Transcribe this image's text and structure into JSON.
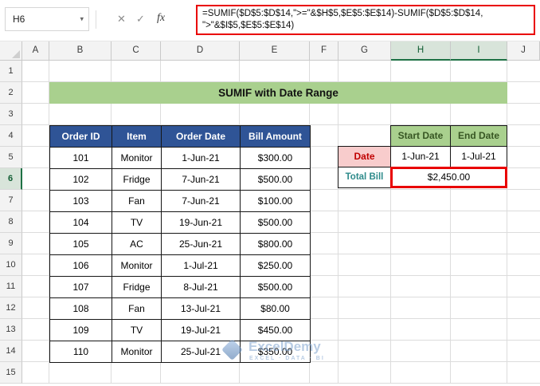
{
  "formula_bar": {
    "name_box": "H6",
    "dropdown_icon": "▾",
    "cancel_label": "✕",
    "enter_label": "✓",
    "fx_label": "fx",
    "formula_line1": "=SUMIF($D$5:$D$14,\">=\"&$H$5,$E$5:$E$14)-SUMIF($D$5:$D$14,",
    "formula_line2": "\">\"&$I$5,$E$5:$E$14)"
  },
  "grid": {
    "columns": [
      "A",
      "B",
      "C",
      "D",
      "E",
      "F",
      "G",
      "H",
      "I",
      "J"
    ],
    "selected_columns": [
      "H",
      "I"
    ],
    "rows": [
      "1",
      "2",
      "3",
      "4",
      "5",
      "6",
      "7",
      "8",
      "9",
      "10",
      "11",
      "12",
      "13",
      "14",
      "15"
    ],
    "selected_row": "6"
  },
  "title_banner": "SUMIF with Date Range",
  "main_table": {
    "headers": [
      "Order ID",
      "Item",
      "Order Date",
      "Bill Amount"
    ],
    "rows": [
      {
        "id": "101",
        "item": "Monitor",
        "date": "1-Jun-21",
        "amount": "$300.00"
      },
      {
        "id": "102",
        "item": "Fridge",
        "date": "7-Jun-21",
        "amount": "$500.00"
      },
      {
        "id": "103",
        "item": "Fan",
        "date": "7-Jun-21",
        "amount": "$100.00"
      },
      {
        "id": "104",
        "item": "TV",
        "date": "19-Jun-21",
        "amount": "$500.00"
      },
      {
        "id": "105",
        "item": "AC",
        "date": "25-Jun-21",
        "amount": "$800.00"
      },
      {
        "id": "106",
        "item": "Monitor",
        "date": "1-Jul-21",
        "amount": "$250.00"
      },
      {
        "id": "107",
        "item": "Fridge",
        "date": "8-Jul-21",
        "amount": "$500.00"
      },
      {
        "id": "108",
        "item": "Fan",
        "date": "13-Jul-21",
        "amount": "$80.00"
      },
      {
        "id": "109",
        "item": "TV",
        "date": "19-Jul-21",
        "amount": "$450.00"
      },
      {
        "id": "110",
        "item": "Monitor",
        "date": "25-Jul-21",
        "amount": "$350.00"
      }
    ]
  },
  "range_table": {
    "headers": [
      "Start Date",
      "End Date"
    ],
    "date_label": "Date",
    "start_date": "1-Jun-21",
    "end_date": "1-Jul-21",
    "total_label": "Total Bill",
    "total_value": "$2,450.00"
  },
  "watermark": {
    "brand": "ExcelDemy",
    "tagline": "EXCEL · DATA · BI"
  },
  "colors": {
    "banner_green": "#A9D08E",
    "table_header_blue": "#2F5496",
    "range_header_green": "#A9D08E",
    "range_header_text": "#375623",
    "date_label_red": "#C00000",
    "date_label_fill": "#F8CCCC",
    "total_label_teal": "#2E8B8B",
    "annotation_red": "#E90000",
    "selection_green": "#1E7145"
  }
}
